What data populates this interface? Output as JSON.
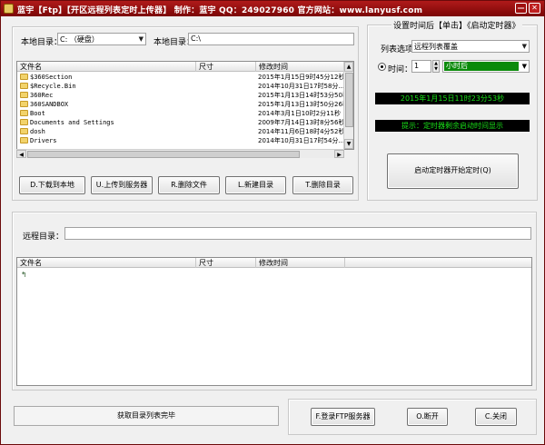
{
  "titlebar": {
    "title": "蓝宇【Ftp】【开区远程列表定时上传器】 制作：蓝宇 QQ：249027960 官方网站：www.lanyusf.com",
    "minimize": "—",
    "close": "✕"
  },
  "local": {
    "dir_label": "本地目录：",
    "drive_value": "C: （硬盘）",
    "dir2_label": "本地目录：",
    "dir2_value": "C:\\",
    "columns": [
      "文件名",
      "尺寸",
      "修改时间"
    ],
    "files": [
      {
        "name": "$360Section",
        "modified": "2015年1月15日9时45分12秒"
      },
      {
        "name": "$Recycle.Bin",
        "modified": "2014年10月31日17时58分..."
      },
      {
        "name": "360Rec",
        "modified": "2015年1月13日14时53分50秒"
      },
      {
        "name": "360SANDBOX",
        "modified": "2015年1月13日13时50分26秒"
      },
      {
        "name": "Boot",
        "modified": "2014年3月1日10时2分11秒"
      },
      {
        "name": "Documents and Settings",
        "modified": "2009年7月14日13时8分56秒"
      },
      {
        "name": "dosh",
        "modified": "2014年11月6日18时4分52秒"
      },
      {
        "name": "Drivers",
        "modified": "2014年10月31日17时54分..."
      }
    ]
  },
  "actions": {
    "download": "D.下载到本地",
    "upload": "U.上传到服务器",
    "delete_file": "R.删除文件",
    "new_dir": "L.新建目录",
    "delete_dir": "T.删除目录"
  },
  "timer": {
    "group_title": "设置时间后【单击】《启动定时器》",
    "list_option_label": "列表选项",
    "list_option_value": "远程列表覆盖",
    "time_label": "时间：",
    "time_value": "1",
    "unit_value": "小时后",
    "clock": "2015年1月15日11时23分53秒",
    "hint": "提示：定时器剩余启动时间显示",
    "start_button": "启动定时器开始定时(Q)"
  },
  "remote": {
    "dir_label": "远程目录：",
    "dir_value": "",
    "columns": [
      "文件名",
      "尺寸",
      "修改时间"
    ]
  },
  "bottom": {
    "status": "获取目录列表完毕",
    "login": "F.登录FTP服务器",
    "disconnect": "O.断开",
    "close": "C.关闭"
  },
  "colors": {
    "titlebar": "#8a0a0a",
    "led_text": "#18e018",
    "unit_selected": "#0a8a0a"
  }
}
